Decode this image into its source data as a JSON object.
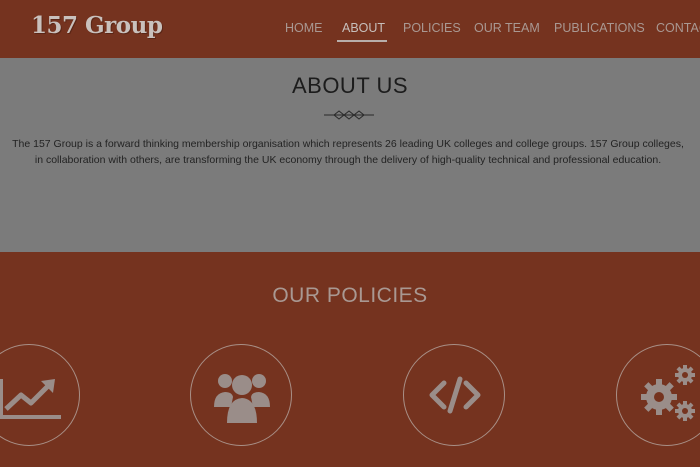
{
  "header": {
    "logo": "157 Group",
    "nav": [
      {
        "label": "HOME"
      },
      {
        "label": "ABOUT",
        "active": true
      },
      {
        "label": "POLICIES"
      },
      {
        "label": "OUR TEAM"
      },
      {
        "label": "PUBLICATIONS"
      },
      {
        "label": "CONTAC"
      }
    ]
  },
  "about": {
    "title": "ABOUT US",
    "line1": "The 157 Group is a forward thinking membership organisation which represents 26 leading UK colleges and college groups. 157 Group colleges,",
    "line2": "in collaboration with others, are transforming the UK economy through the delivery of high-quality technical and professional education."
  },
  "policies": {
    "title": "OUR POLICIES",
    "icons": [
      "chart-growth-icon",
      "users-group-icon",
      "code-icon",
      "gears-icon"
    ]
  },
  "colors": {
    "header_bg": "#75331f",
    "about_bg": "#7b7b7b",
    "policies_bg": "#75331f",
    "nav_text": "#a99892"
  }
}
